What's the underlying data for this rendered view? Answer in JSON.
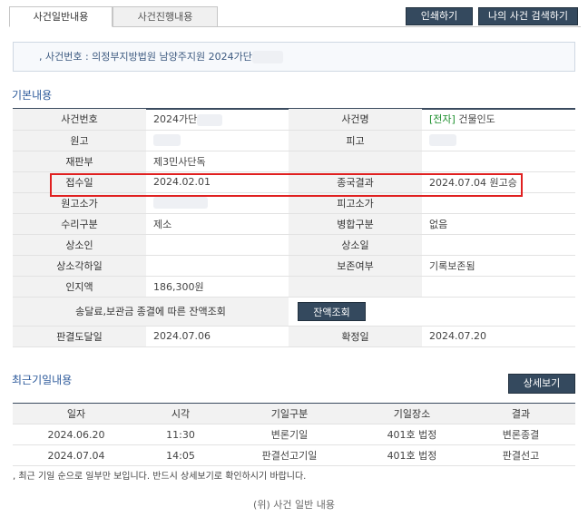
{
  "tabs": [
    {
      "label": "사건일반내용",
      "active": true
    },
    {
      "label": "사건진행내용",
      "active": false
    }
  ],
  "buttons": {
    "print": "인쇄하기",
    "my_case_search": "나의 사건 검색하기",
    "balance_inquiry": "잔액조회",
    "detail_view": "상세보기"
  },
  "case_header": {
    "text": "사건번호 : 의정부지방법원 남양주지원 2024가단"
  },
  "basic_info": {
    "title": "기본내용",
    "case_number_label": "사건번호",
    "case_number_value": "2024가단",
    "case_name_label": "사건명",
    "case_name_tag": "[전자]",
    "case_name_value": " 건물인도",
    "plaintiff_label": "원고",
    "defendant_label": "피고",
    "division_label": "재판부",
    "division_value": "제3민사단독",
    "filed_date_label": "접수일",
    "filed_date_value": "2024.02.01",
    "final_result_label": "종국결과",
    "final_result_value": "2024.07.04 원고승",
    "plaintiff_value_label": "원고소가",
    "defendant_value_label": "피고소가",
    "acceptance_type_label": "수리구분",
    "acceptance_type_value": "제소",
    "merge_type_label": "병합구분",
    "merge_type_value": "없음",
    "appellant_label": "상소인",
    "appellee_label": "상소일",
    "appeal_dismissed_label": "상소각하일",
    "preservation_label": "보존여부",
    "preservation_value": "기록보존됨",
    "stamp_fee_label": "인지액",
    "stamp_fee_value": "186,300원",
    "deposit_label": "송달료,보관금 종결에 따른 잔액조회",
    "delivery_date_label": "판결도달일",
    "delivery_date_value": "2024.07.06",
    "confirmed_date_label": "확정일",
    "confirmed_date_value": "2024.07.20"
  },
  "recent_hearings": {
    "title": "최근기일내용",
    "headers": [
      "일자",
      "시각",
      "기일구분",
      "기일장소",
      "결과"
    ],
    "rows": [
      [
        "2024.06.20",
        "11:30",
        "변론기일",
        "401호 법정",
        "변론종결"
      ],
      [
        "2024.07.04",
        "14:05",
        "판결선고기일",
        "401호 법정",
        "판결선고"
      ]
    ],
    "notice": "최근 기일 순으로 일부만 보입니다. 반드시 상세보기로 확인하시기 바랍니다."
  },
  "caption": "(위) 사건 일반 내용",
  "colors": {
    "highlight": "#e02020",
    "accent": "#2d5a9b",
    "button": "#34495e",
    "electronic_tag": "#1d8f2e"
  }
}
